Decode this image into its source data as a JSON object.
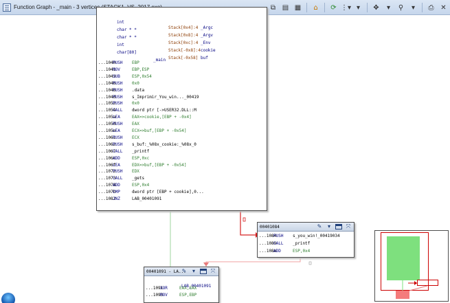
{
  "window": {
    "title": "Function Graph - _main - 3 vertices  (STACK1_VS_2017.exe)"
  },
  "toolbar": {
    "icons": [
      "copy-icon",
      "paste-icon",
      "snapshot-icon",
      "home-icon",
      "refresh-icon",
      "layout-icon",
      "nav-icon",
      "zoom-icon",
      "print-icon",
      "close-icon"
    ]
  },
  "main_block": {
    "variables": [
      {
        "type": "int",
        "loc": "Stack[0x4]:4",
        "name": "_Argc"
      },
      {
        "type": "char * *",
        "loc": "Stack[0x8]:4",
        "name": "_Argv"
      },
      {
        "type": "char * *",
        "loc": "Stack[0xc]:4",
        "name": "_Env"
      },
      {
        "type": "int",
        "loc": "Stack[-0x8]:4",
        "name": "cookie"
      },
      {
        "type": "char[80]",
        "loc": "Stack[-0x58]",
        "name": "buf"
      }
    ],
    "label": "_main",
    "instructions": [
      {
        "addr": "...1040",
        "mn": "PUSH",
        "op": "EBP"
      },
      {
        "addr": "...1041",
        "mn": "MOV",
        "op": "EBP,ESP"
      },
      {
        "addr": "...1043",
        "mn": "SUB",
        "op": "ESP,0x54"
      },
      {
        "addr": "...1046",
        "mn": "PUSH",
        "op": "0x0"
      },
      {
        "addr": "...1048",
        "mn": "PUSH",
        "op": ".data"
      },
      {
        "addr": "...104d",
        "mn": "PUSH",
        "op": "s_Imprimir_You_win..._00419"
      },
      {
        "addr": "...1052",
        "mn": "PUSH",
        "op": "0x0"
      },
      {
        "addr": "...1054",
        "mn": "CALL",
        "op": "dword ptr [->USER32.DLL::M"
      },
      {
        "addr": "...105a",
        "mn": "LEA",
        "op": "EAX=>cookie,[EBP + -0x4]"
      },
      {
        "addr": "...105d",
        "mn": "PUSH",
        "op": "EAX"
      },
      {
        "addr": "...105e",
        "mn": "LEA",
        "op": "ECX=>buf,[EBP + -0x54]"
      },
      {
        "addr": "...1061",
        "mn": "PUSH",
        "op": "ECX"
      },
      {
        "addr": "...1062",
        "mn": "PUSH",
        "op": "s_buf:_%08x_cookie:_%08x_0"
      },
      {
        "addr": "...1067",
        "mn": "CALL",
        "op": "_printf"
      },
      {
        "addr": "...106c",
        "mn": "ADD",
        "op": "ESP,0xc"
      },
      {
        "addr": "...106f",
        "mn": "LEA",
        "op": "EDX=>buf,[EBP + -0x54]"
      },
      {
        "addr": "...1072",
        "mn": "PUSH",
        "op": "EDX"
      },
      {
        "addr": "...1073",
        "mn": "CALL",
        "op": "_gets"
      },
      {
        "addr": "...1078",
        "mn": "ADD",
        "op": "ESP,0x4"
      },
      {
        "addr": "...107b",
        "mn": "CMP",
        "op": "dword ptr [EBP + cookie],0..."
      },
      {
        "addr": "...1082",
        "mn": "JNZ",
        "op": "LAB_00401091"
      }
    ]
  },
  "block_1084": {
    "header": "00401084",
    "instructions": [
      {
        "addr": "...1084",
        "mn": "PUSH",
        "op": "s_you_win!_00419034"
      },
      {
        "addr": "...1089",
        "mn": "CALL",
        "op": "_printf"
      },
      {
        "addr": "...108e",
        "mn": "ADD",
        "op": "ESP,0x4"
      }
    ]
  },
  "block_1091": {
    "header": "00401091 - LA...",
    "label": "LAB_00401091",
    "instructions": [
      {
        "addr": "...1091",
        "mn": "XOR",
        "op": "EAX,EAX"
      },
      {
        "addr": "...1093",
        "mn": "MOV",
        "op": "ESP,EBP"
      }
    ]
  },
  "colors": {
    "titlebar": "#c6d6ec",
    "mnemonic": "#000080",
    "stack_loc": "#8b3a00",
    "edge_true": "#2e9e2e",
    "edge_false": "#d62020",
    "overview_main": "#7ee07e",
    "overview_exit": "#f47c7c"
  }
}
